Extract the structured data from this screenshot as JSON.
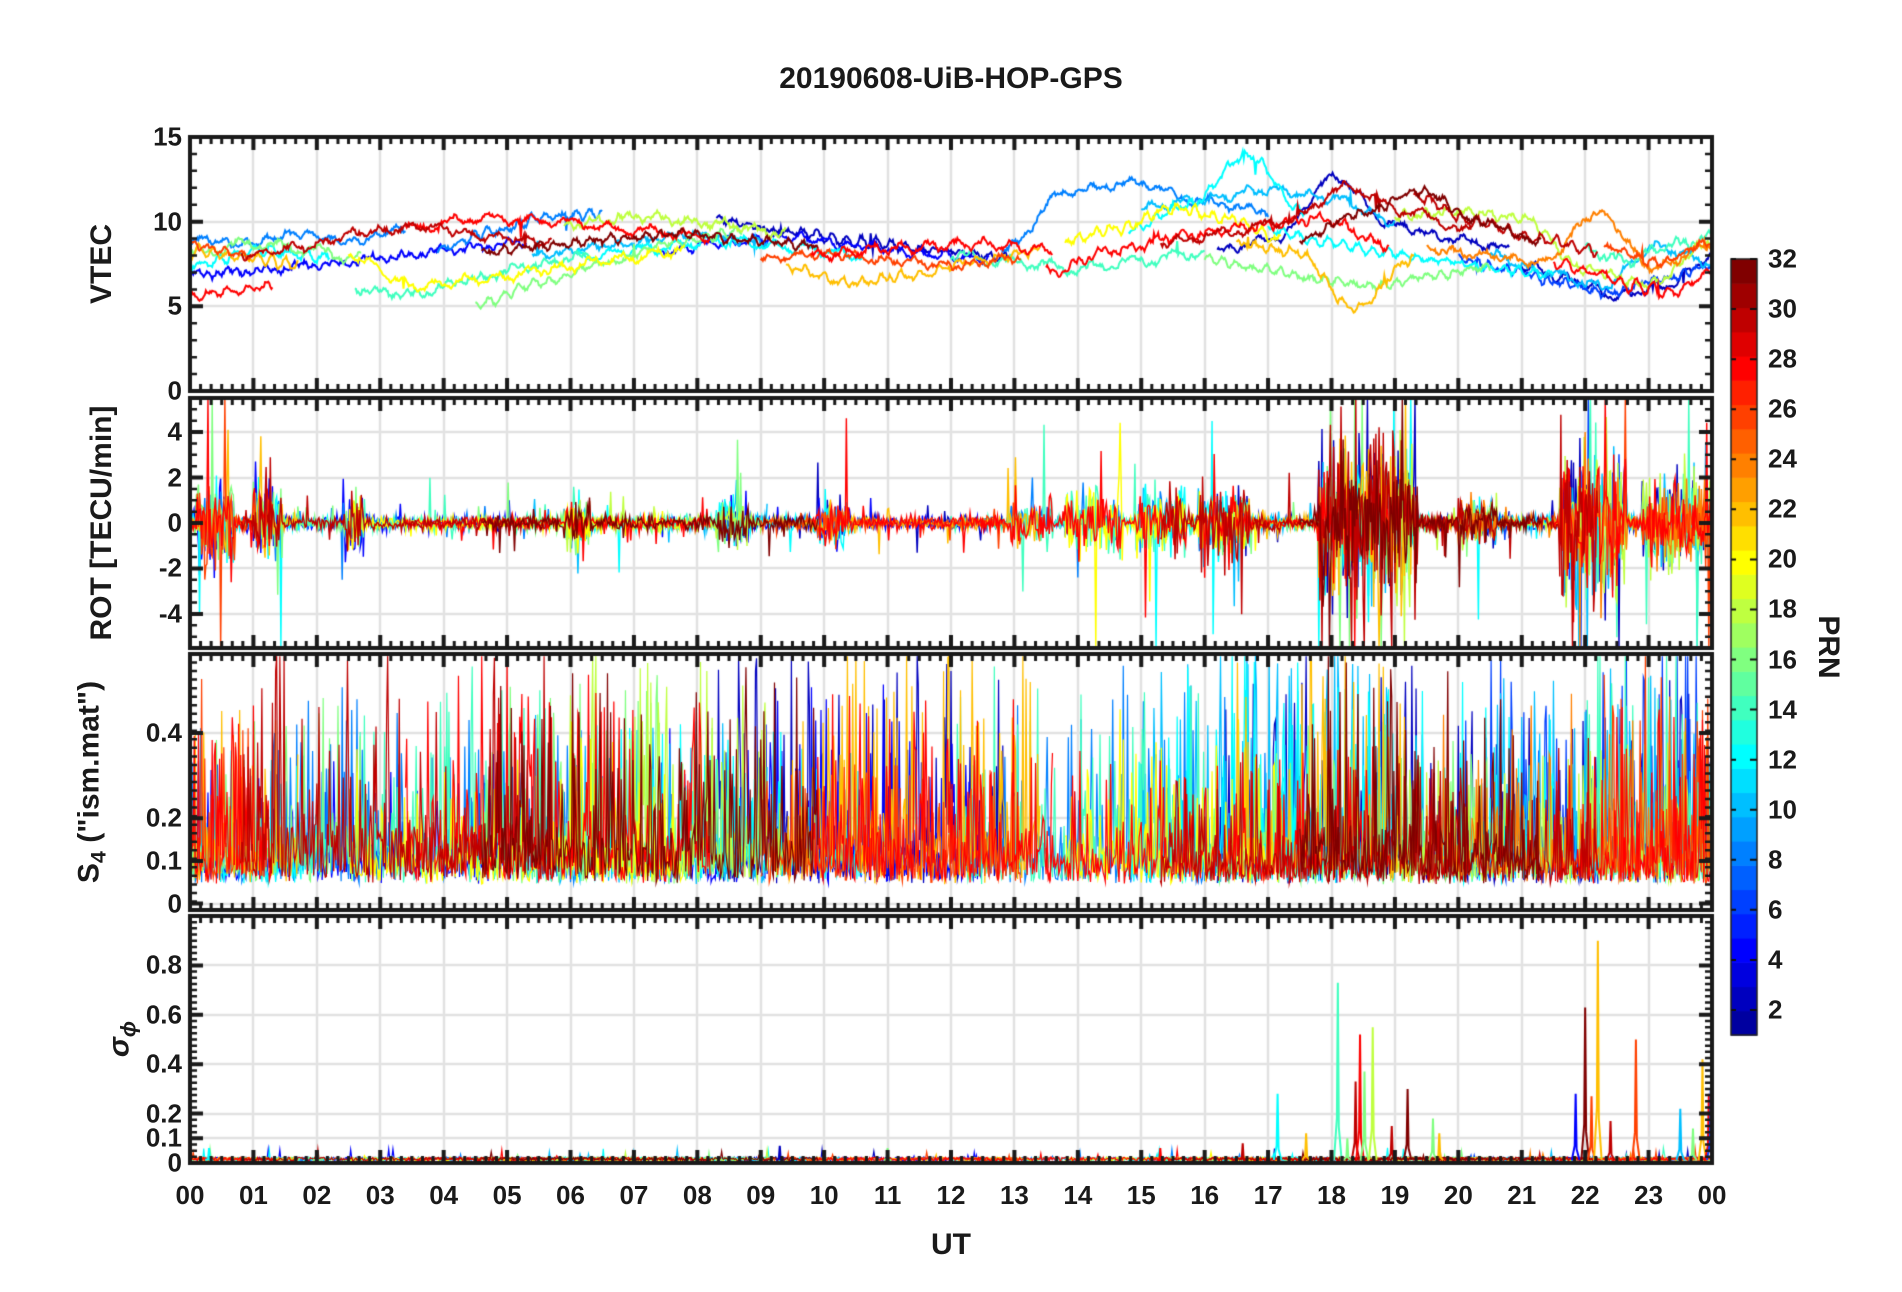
{
  "title": "20190608-UiB-HOP-GPS",
  "xlabel": "UT",
  "x_ticks": [
    "00",
    "01",
    "02",
    "03",
    "04",
    "05",
    "06",
    "07",
    "08",
    "09",
    "10",
    "11",
    "12",
    "13",
    "14",
    "15",
    "16",
    "17",
    "18",
    "19",
    "20",
    "21",
    "22",
    "23",
    "00"
  ],
  "colorbar": {
    "label": "PRN",
    "tick_values": [
      2,
      4,
      6,
      8,
      10,
      12,
      14,
      16,
      18,
      20,
      22,
      24,
      26,
      28,
      30,
      32
    ],
    "range": [
      1,
      32
    ],
    "colors": [
      "#0000A0",
      "#0000BF",
      "#0000DF",
      "#0000FF",
      "#0020FF",
      "#0040FF",
      "#0060FF",
      "#0080FF",
      "#00A0FF",
      "#00BFFF",
      "#00DFFF",
      "#00FFFF",
      "#20FFDF",
      "#40FFBF",
      "#60FF9F",
      "#80FF80",
      "#9FFF60",
      "#BFFF40",
      "#DFFF20",
      "#FFFF00",
      "#FFDF00",
      "#FFBF00",
      "#FF9F00",
      "#FF8000",
      "#FF6000",
      "#FF4000",
      "#FF2000",
      "#FF0000",
      "#DF0000",
      "#BF0000",
      "#9F0000",
      "#800000"
    ]
  },
  "frame_color": "#1a1a1a",
  "grid_color": "#e2e2e2",
  "chart_data": [
    {
      "type": "line",
      "ylabel": "VTEC",
      "ylim": [
        0,
        15
      ],
      "ytick_values": [
        0,
        5,
        10,
        15
      ],
      "ytick_labels": [
        "0",
        "5",
        "10",
        "15"
      ],
      "minor_step": 1,
      "x_range_hours": [
        0,
        24
      ],
      "grid": true,
      "noise_amp": 0.2,
      "series": [
        {
          "prn": 8,
          "t0": 0,
          "t1": 3.4,
          "values": [
            9.0,
            8.7,
            9.3,
            8.8,
            9.6
          ]
        },
        {
          "prn": 4,
          "t0": 0,
          "t1": 5.3,
          "values": [
            6.9,
            7.1,
            7.5,
            7.9,
            8.4,
            8.8
          ]
        },
        {
          "prn": 28,
          "t0": 0,
          "t1": 1.3,
          "values": [
            5.6,
            5.9,
            6.2
          ]
        },
        {
          "prn": 26,
          "t0": 0,
          "t1": 1.0,
          "values": [
            8.6,
            8.0
          ]
        },
        {
          "prn": 22,
          "t0": 0,
          "t1": 1.7,
          "values": [
            8.3,
            7.9,
            7.5
          ]
        },
        {
          "prn": 16,
          "t0": 0,
          "t1": 2.7,
          "values": [
            8.1,
            8.7,
            8.4,
            7.8
          ]
        },
        {
          "prn": 12,
          "t0": 0,
          "t1": 2.2,
          "values": [
            7.4,
            8.3,
            7.9
          ]
        },
        {
          "prn": 30,
          "t0": 0.8,
          "t1": 5.7,
          "values": [
            8.0,
            8.5,
            9.4,
            9.7,
            9.1,
            8.8
          ]
        },
        {
          "prn": 20,
          "t0": 2.5,
          "t1": 7.8,
          "values": [
            8.0,
            6.2,
            6.6,
            7.2,
            7.8,
            8.3
          ]
        },
        {
          "prn": 14,
          "t0": 2.6,
          "t1": 6.3,
          "values": [
            6.0,
            5.7,
            6.6,
            7.4,
            8.0
          ]
        },
        {
          "prn": 16,
          "t0": 4.5,
          "t1": 8.7,
          "values": [
            5.1,
            6.4,
            7.6,
            8.8,
            9.4
          ]
        },
        {
          "prn": 8,
          "t0": 3.9,
          "t1": 6.5,
          "values": [
            8.4,
            9.4,
            10.3,
            10.5
          ]
        },
        {
          "prn": 28,
          "t0": 3.4,
          "t1": 8.2,
          "values": [
            9.6,
            10.2,
            10.0,
            9.5,
            9.1
          ]
        },
        {
          "prn": 32,
          "t0": 4.6,
          "t1": 9.9,
          "values": [
            8.2,
            8.6,
            9.0,
            9.3,
            8.9,
            8.6
          ]
        },
        {
          "prn": 10,
          "t0": 5.4,
          "t1": 9.1,
          "values": [
            8.0,
            8.6,
            9.2,
            8.8
          ]
        },
        {
          "prn": 12,
          "t0": 6.1,
          "t1": 10.6,
          "values": [
            7.9,
            8.4,
            8.9,
            8.5,
            8.0
          ]
        },
        {
          "prn": 18,
          "t0": 5.9,
          "t1": 9.4,
          "values": [
            9.8,
            10.3,
            9.9,
            9.3
          ]
        },
        {
          "prn": 4,
          "t0": 7.4,
          "t1": 12.6,
          "values": [
            8.2,
            8.8,
            9.1,
            8.6,
            8.1,
            7.8
          ]
        },
        {
          "prn": 2,
          "t0": 8.3,
          "t1": 12.9,
          "values": [
            10.1,
            9.4,
            8.8,
            8.3,
            7.9
          ]
        },
        {
          "prn": 22,
          "t0": 9.4,
          "t1": 13.4,
          "values": [
            7.3,
            6.4,
            6.8,
            7.7,
            8.3
          ]
        },
        {
          "prn": 26,
          "t0": 9.0,
          "t1": 13.1,
          "values": [
            7.8,
            8.1,
            7.7,
            7.4,
            7.9
          ]
        },
        {
          "prn": 28,
          "t0": 9.8,
          "t1": 13.6,
          "values": [
            8.0,
            8.4,
            8.7,
            8.3
          ]
        },
        {
          "prn": 8,
          "t0": 12.8,
          "t1": 17.0,
          "values": [
            8.3,
            11.8,
            12.3,
            11.2,
            10.6
          ]
        },
        {
          "prn": 14,
          "t0": 12.0,
          "t1": 16.0,
          "values": [
            8.0,
            7.6,
            7.2,
            7.7,
            8.2
          ]
        },
        {
          "prn": 20,
          "t0": 13.8,
          "t1": 17.2,
          "values": [
            8.9,
            9.6,
            10.8,
            10.2,
            9.0
          ]
        },
        {
          "prn": 12,
          "t0": 14.8,
          "t1": 17.6,
          "values": [
            9.5,
            11.0,
            13.9,
            10.5
          ]
        },
        {
          "prn": 28,
          "t0": 13.5,
          "t1": 18.9,
          "values": [
            7.0,
            8.3,
            9.2,
            9.7,
            10.2,
            8.6
          ]
        },
        {
          "prn": 10,
          "t0": 15.0,
          "t1": 19.0,
          "values": [
            10.8,
            11.3,
            11.9,
            11.4,
            10.0
          ]
        },
        {
          "prn": 30,
          "t0": 15.3,
          "t1": 20.2,
          "values": [
            8.7,
            9.3,
            10.0,
            12.0,
            10.6,
            9.4
          ]
        },
        {
          "prn": 2,
          "t0": 16.2,
          "t1": 20.8,
          "values": [
            8.3,
            9.0,
            12.6,
            9.8,
            9.0,
            8.4
          ]
        },
        {
          "prn": 16,
          "t0": 16.0,
          "t1": 20.5,
          "values": [
            7.8,
            7.2,
            6.6,
            6.2,
            6.8,
            7.3
          ]
        },
        {
          "prn": 22,
          "t0": 16.5,
          "t1": 19.3,
          "values": [
            8.7,
            8.2,
            4.9,
            7.8
          ]
        },
        {
          "prn": 32,
          "t0": 17.5,
          "t1": 21.3,
          "values": [
            9.0,
            10.5,
            11.8,
            10.0,
            8.8
          ]
        },
        {
          "prn": 12,
          "t0": 17.0,
          "t1": 21.5,
          "values": [
            9.5,
            8.8,
            8.2,
            7.7,
            7.2,
            6.9
          ]
        },
        {
          "prn": 18,
          "t0": 19.0,
          "t1": 24,
          "values": [
            10.3,
            10.6,
            10.2,
            7.2,
            6.3,
            8.8
          ]
        },
        {
          "prn": 24,
          "t0": 19.5,
          "t1": 24,
          "values": [
            8.4,
            8.0,
            7.6,
            10.5,
            7.3,
            8.6
          ]
        },
        {
          "prn": 6,
          "t0": 20.0,
          "t1": 24,
          "values": [
            7.8,
            7.2,
            6.4,
            5.8,
            6.6,
            7.4
          ]
        },
        {
          "prn": 10,
          "t0": 20.5,
          "t1": 24,
          "values": [
            8.0,
            7.0,
            6.2,
            8.5,
            7.6
          ]
        },
        {
          "prn": 2,
          "t0": 21.0,
          "t1": 24,
          "values": [
            7.4,
            6.6,
            5.6,
            6.2,
            7.9
          ]
        },
        {
          "prn": 28,
          "t0": 21.5,
          "t1": 24,
          "values": [
            7.6,
            7.0,
            6.2,
            5.8,
            7.0
          ]
        },
        {
          "prn": 30,
          "t0": 19.3,
          "t1": 22.2,
          "values": [
            11.5,
            10.0,
            9.0,
            8.3
          ]
        },
        {
          "prn": 26,
          "t0": 22.3,
          "t1": 24,
          "values": [
            8.5,
            7.6,
            8.8
          ]
        },
        {
          "prn": 14,
          "t0": 22.0,
          "t1": 24,
          "values": [
            8.3,
            7.7,
            8.6,
            9.0
          ]
        }
      ]
    },
    {
      "type": "line",
      "ylabel": "ROT [TECU/min]",
      "ylim": [
        -5.5,
        5.5
      ],
      "ytick_values": [
        -4,
        -2,
        0,
        2,
        4
      ],
      "ytick_labels": [
        "-4",
        "-2",
        "0",
        "2",
        "4"
      ],
      "minor_step": 0.5,
      "grid": true,
      "base_amplitude": 0.22,
      "bursts": [
        [
          0.1,
          0.7,
          1.0
        ],
        [
          1.0,
          1.45,
          1.1
        ],
        [
          2.4,
          2.75,
          0.8
        ],
        [
          5.9,
          6.3,
          0.5
        ],
        [
          8.3,
          8.8,
          0.5
        ],
        [
          9.9,
          10.4,
          0.5
        ],
        [
          12.9,
          13.6,
          0.6
        ],
        [
          13.8,
          14.7,
          0.8
        ],
        [
          14.9,
          15.7,
          0.8
        ],
        [
          15.9,
          16.7,
          0.8
        ],
        [
          17.8,
          19.35,
          2.2
        ],
        [
          20.0,
          20.6,
          0.5
        ],
        [
          21.6,
          22.65,
          2.0
        ],
        [
          22.9,
          24.0,
          1.1
        ]
      ]
    },
    {
      "type": "line",
      "ylabel_parts": {
        "base": "S",
        "sub": "4",
        "rest": " (\"ism.mat\")"
      },
      "ylim": [
        -0.015,
        0.585
      ],
      "ytick_values": [
        0,
        0.1,
        0.2,
        0.4
      ],
      "ytick_labels": [
        "0",
        "0.1",
        "0.2",
        "0.4"
      ],
      "minor_step": 0.02,
      "grid": true,
      "baseline": 0.05,
      "spike_max": 0.55,
      "activity_boost": [
        [
          6.0,
          6.5,
          1.25
        ],
        [
          10.8,
          11.3,
          1.25
        ],
        [
          17.5,
          19.2,
          1.15
        ],
        [
          21.5,
          23.9,
          1.15
        ]
      ]
    },
    {
      "type": "line",
      "ylabel_parts": {
        "base": "σ",
        "sub": "ϕ"
      },
      "ylim": [
        0,
        1.0
      ],
      "ytick_values": [
        0,
        0.1,
        0.2,
        0.4,
        0.6,
        0.8
      ],
      "ytick_labels": [
        "0",
        "0.1",
        "0.2",
        "0.4",
        "0.6",
        "0.8"
      ],
      "minor_step": 0.025,
      "grid": true,
      "baseline": 0.015,
      "spikes": [
        [
          0.3,
          12,
          0.06
        ],
        [
          2.0,
          16,
          0.05
        ],
        [
          5.0,
          22,
          0.05
        ],
        [
          9.3,
          2,
          0.07
        ],
        [
          11.0,
          16,
          0.06
        ],
        [
          13.0,
          26,
          0.05
        ],
        [
          15.3,
          28,
          0.06
        ],
        [
          16.6,
          30,
          0.08
        ],
        [
          17.15,
          12,
          0.28
        ],
        [
          17.6,
          22,
          0.12
        ],
        [
          18.1,
          14,
          0.73
        ],
        [
          18.25,
          16,
          0.1
        ],
        [
          18.38,
          30,
          0.33
        ],
        [
          18.45,
          28,
          0.52
        ],
        [
          18.52,
          16,
          0.37
        ],
        [
          18.65,
          18,
          0.55
        ],
        [
          18.95,
          30,
          0.15
        ],
        [
          19.2,
          32,
          0.3
        ],
        [
          19.6,
          16,
          0.18
        ],
        [
          19.7,
          22,
          0.12
        ],
        [
          21.85,
          4,
          0.28
        ],
        [
          22.0,
          32,
          0.63
        ],
        [
          22.1,
          26,
          0.27
        ],
        [
          22.2,
          22,
          0.9
        ],
        [
          22.4,
          30,
          0.17
        ],
        [
          22.8,
          26,
          0.5
        ],
        [
          23.5,
          10,
          0.22
        ],
        [
          23.7,
          16,
          0.14
        ],
        [
          23.85,
          22,
          0.42
        ],
        [
          23.95,
          28,
          0.28
        ],
        [
          23.98,
          6,
          0.3
        ]
      ]
    }
  ]
}
